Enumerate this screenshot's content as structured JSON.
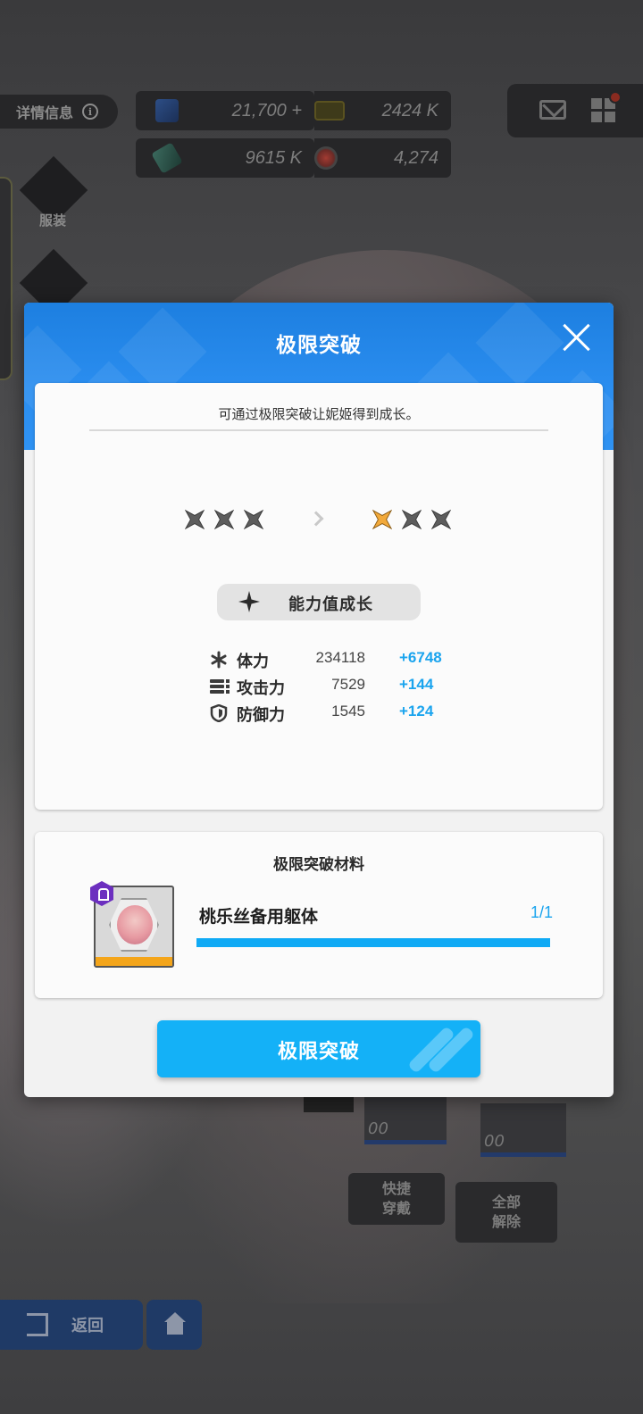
{
  "background": {
    "info_label": "详情信息",
    "resources": {
      "crystal": "21,700",
      "crystal_suffix": "+",
      "card": "2424 K",
      "material": "9615 K",
      "orb": "4,274"
    },
    "side_menu": {
      "outfit_label": "服装"
    },
    "quick_equip_label": "快捷\n穿戴",
    "unequip_all_label": "全部\n解除",
    "back_label": "返回",
    "card_levels": [
      "00",
      "00"
    ]
  },
  "modal": {
    "title": "极限突破",
    "subtitle": "可通过极限突破让妮姬得到成长。",
    "stars_current": {
      "filled": 0,
      "total": 3
    },
    "stars_next": {
      "filled": 1,
      "total": 3
    },
    "growth_label": "能力值成长",
    "stats": [
      {
        "icon": "asterisk-icon",
        "name": "体力",
        "value": "234118",
        "bonus": "+6748"
      },
      {
        "icon": "bullets-icon",
        "name": "攻击力",
        "value": "7529",
        "bonus": "+144"
      },
      {
        "icon": "shield-icon",
        "name": "防御力",
        "value": "1545",
        "bonus": "+124"
      }
    ],
    "material_section": {
      "title": "极限突破材料",
      "item_name": "桃乐丝备用躯体",
      "count": "1/1",
      "progress": 1.0
    },
    "action_label": "极限突破"
  },
  "colors": {
    "header_blue": "#2b8ef0",
    "accent_blue": "#14b1f7",
    "bonus_blue": "#1aa4ee",
    "star_gold": "#f2a93a",
    "star_gray": "#5d5d5d"
  }
}
